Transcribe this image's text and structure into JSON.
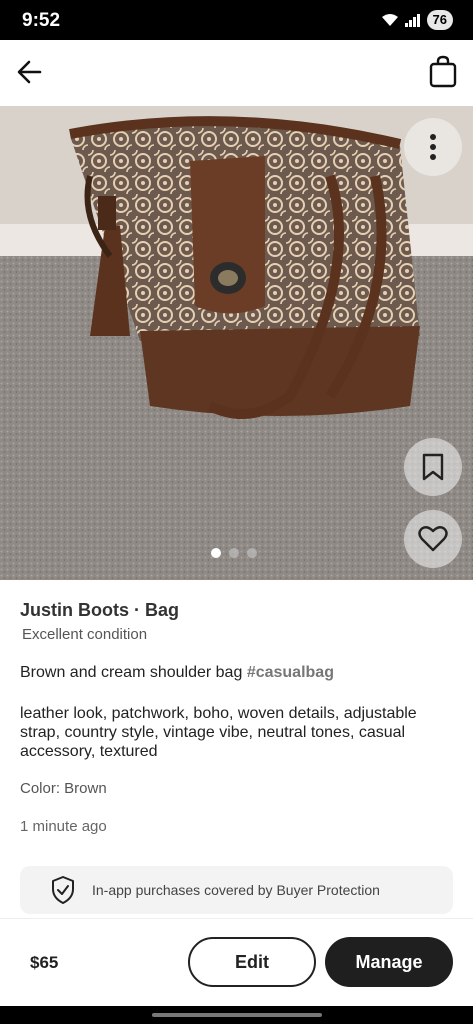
{
  "status": {
    "time": "9:52",
    "battery": "76",
    "icons": [
      "wifi-icon",
      "signal-icon",
      "battery-icon"
    ]
  },
  "header": {
    "back_icon": "arrow-left-icon",
    "bag_icon": "shopping-bag-icon"
  },
  "gallery": {
    "image_count": 3,
    "active_index": 0,
    "more_icon": "more-vertical-icon",
    "save_icon": "bookmark-icon",
    "like_icon": "heart-icon"
  },
  "listing": {
    "brand_line": "Justin Boots · Bag",
    "condition": "Excellent condition",
    "title": "Brown and cream shoulder bag",
    "hashtag": "#casualbag",
    "description": "leather look, patchwork, boho, woven details, adjustable strap, country style, vintage vibe, neutral tones, casual accessory, textured",
    "color": "Color: Brown",
    "posted": "1 minute ago"
  },
  "protection": {
    "text": "In-app purchases covered by Buyer Protection",
    "icon": "shield-check-icon"
  },
  "footer": {
    "price": "$65",
    "edit_label": "Edit",
    "manage_label": "Manage"
  },
  "colors": {
    "accent": "#1f1f1f",
    "hashtag": "#777777",
    "protect_bg": "#f3f3f3"
  }
}
